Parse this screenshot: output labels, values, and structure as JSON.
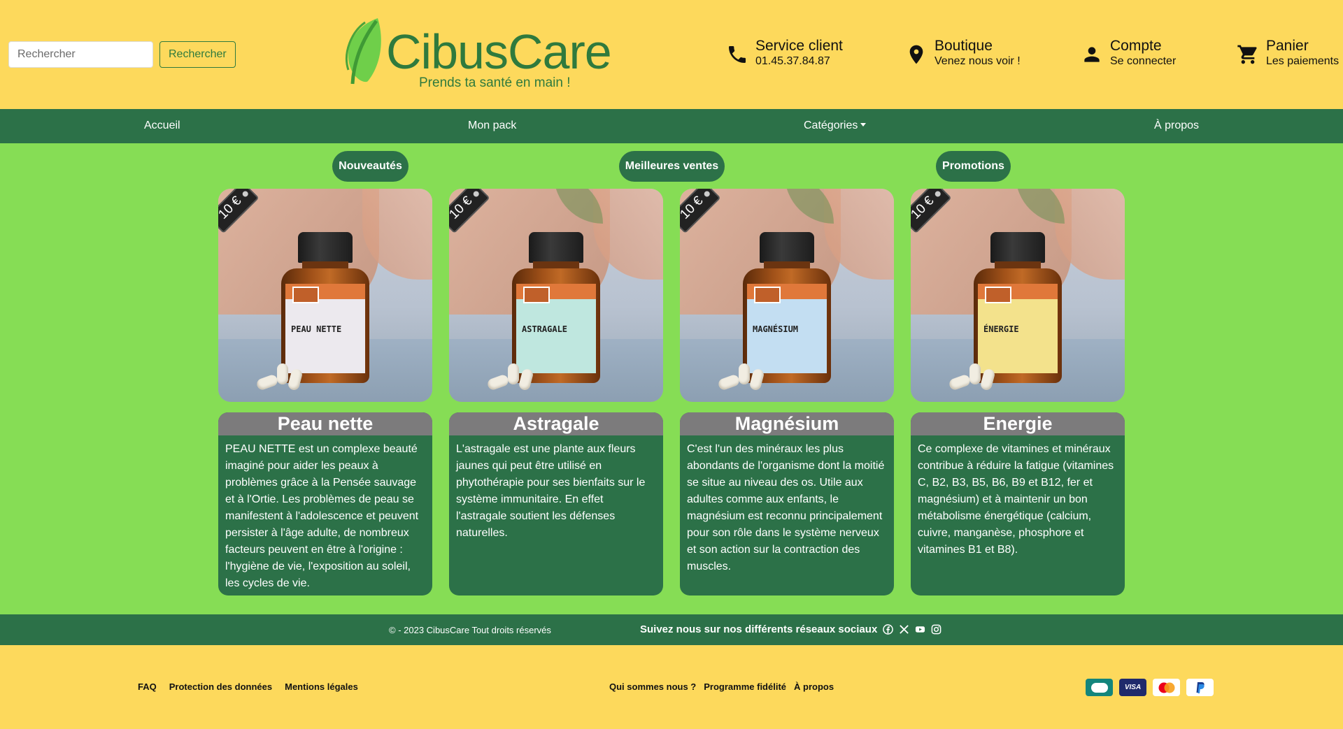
{
  "search": {
    "placeholder": "Rechercher",
    "button_label": "Rechercher"
  },
  "logo": {
    "name": "CibusCare",
    "tagline": "Prends ta santé en main !"
  },
  "header_items": [
    {
      "title": "Service client",
      "subtitle": "01.45.37.84.87",
      "icon": "phone-icon"
    },
    {
      "title": "Boutique",
      "subtitle": "Venez nous voir !",
      "icon": "location-pin-icon"
    },
    {
      "title": "Compte",
      "subtitle": "Se connecter",
      "icon": "user-icon"
    },
    {
      "title": "Panier",
      "subtitle": "Les paiements",
      "icon": "cart-icon"
    }
  ],
  "nav": {
    "home": "Accueil",
    "pack": "Mon pack",
    "categories": "Catégories",
    "about": "À propos"
  },
  "sections": {
    "new": "Nouveautés",
    "best": "Meilleures ventes",
    "promo": "Promotions"
  },
  "products": [
    {
      "name": "Peau nette",
      "price": "10 €",
      "label": "PEAU NETTE",
      "label_color": "#ece9ee",
      "description": "PEAU NETTE est un complexe beauté imaginé pour aider les peaux à problèmes grâce à la Pensée sauvage et à l'Ortie. Les problèmes de peau se manifestent à l'adolescence et peuvent persister à l'âge adulte, de nombreux facteurs peuvent en être à l'origine : l'hygiène de vie, l'exposition au soleil, les cycles de vie."
    },
    {
      "name": "Astragale",
      "price": "10 €",
      "label": "ASTRAGALE",
      "label_color": "#bfe7df",
      "description": "L'astragale est une plante aux fleurs jaunes qui peut être utilisé en phytothérapie pour ses bienfaits sur le système immunitaire. En effet l'astragale soutient les défenses naturelles."
    },
    {
      "name": "Magnésium",
      "price": "10 €",
      "label": "MAGNÉSIUM",
      "label_color": "#c3def2",
      "description": "C'est l'un des minéraux les plus abondants de l'organisme dont la moitié se situe au niveau des os. Utile aux adultes comme aux enfants, le magnésium est reconnu principalement pour son rôle dans le système nerveux et son action sur la contraction des muscles."
    },
    {
      "name": "Energie",
      "price": "10 €",
      "label": "ÉNERGIE",
      "label_color": "#f3e28c",
      "description": "Ce complexe de vitamines et minéraux contribue à réduire la fatigue (vitamines C, B2, B3, B5, B6, B9 et B12, fer et magnésium) et à maintenir un bon métabolisme énergétique (calcium, cuivre, manganèse, phosphore et vitamines B1 et B8)."
    }
  ],
  "footer": {
    "copyright": "© - 2023 CibusCare Tout droits réservés",
    "social_text": "Suivez nous sur nos différents réseaux sociaux",
    "social_icons": [
      "facebook-icon",
      "x-icon",
      "youtube-icon",
      "instagram-icon"
    ]
  },
  "bottom_links_left": [
    "FAQ",
    "Protection des données",
    "Mentions légales"
  ],
  "bottom_links_right": [
    "Qui sommes nous ?",
    "Programme fidélité",
    "À propos"
  ],
  "payments": [
    "CB",
    "VISA",
    "Mastercard",
    "PayPal"
  ],
  "colors": {
    "header_bg": "#fdd95c",
    "nav_bg": "#2c7148",
    "main_bg": "#86dd55",
    "card_title_bg": "#7c7b7c",
    "logo_green": "#2f7a3d"
  }
}
